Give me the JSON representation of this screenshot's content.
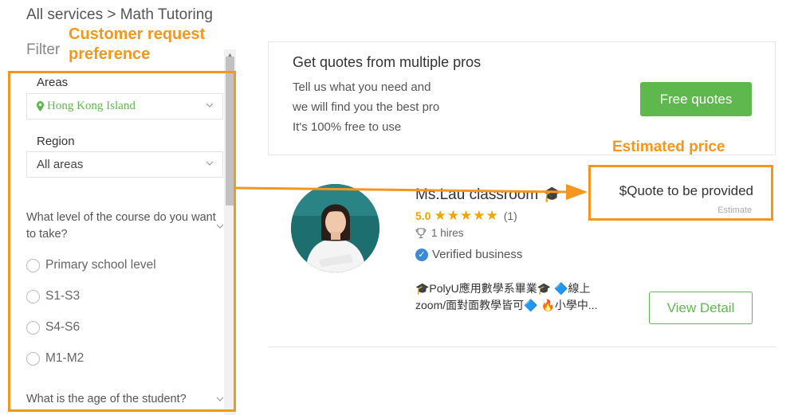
{
  "breadcrumb": "All services > Math Tutoring",
  "filter": {
    "title": "Filter",
    "areas_label": "Areas",
    "areas_value": "Hong Kong Island",
    "region_label": "Region",
    "region_value": "All areas",
    "course_question": "What level of the course do you want to take?",
    "course_options": [
      "Primary school level",
      "S1-S3",
      "S4-S6",
      "M1-M2"
    ],
    "age_question": "What is the age of the student?"
  },
  "annotations": {
    "customer_request_line1": "Customer request",
    "customer_request_line2": "preference",
    "estimated_price": "Estimated price",
    "color": "#f5961e"
  },
  "quotes_card": {
    "title": "Get quotes from multiple pros",
    "lines": [
      "Tell us what you need and",
      "we will find you the best pro",
      "It's 100% free to use"
    ],
    "button_label": "Free quotes",
    "button_color": "#5fb84e"
  },
  "pro": {
    "name": "Ms.Lau classroom 🎓",
    "rating": "5.0",
    "stars": 5,
    "review_count": "(1)",
    "hires": "1 hires",
    "verified": "Verified business",
    "description": "🎓PolyU應用數學系畢業🎓 🔷線上zoom/面對面教學皆可🔷 🔥小學中...",
    "price": "$Quote to be provided",
    "price_sub": "Estimate",
    "detail_button": "View Detail"
  }
}
